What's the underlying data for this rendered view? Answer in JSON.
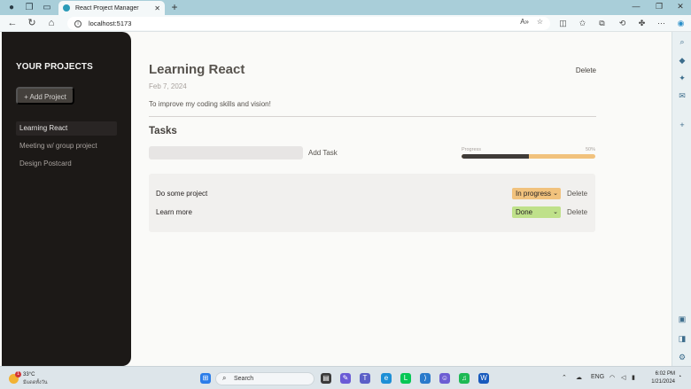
{
  "browser": {
    "tab_title": "React Project Manager",
    "url": "localhost:5173",
    "new_tab_glyph": "+",
    "close_tab_glyph": "✕"
  },
  "sidebar": {
    "heading": "YOUR PROJECTS",
    "add_button": "+ Add Project",
    "projects": [
      {
        "label": "Learning React",
        "active": true
      },
      {
        "label": "Meeting w/ group project",
        "active": false
      },
      {
        "label": "Design Postcard",
        "active": false
      }
    ]
  },
  "project": {
    "title": "Learning React",
    "delete_label": "Delete",
    "date": "Feb 7, 2024",
    "description": "To improve my coding skills and vision!"
  },
  "tasks_section": {
    "heading": "Tasks",
    "input_placeholder": "",
    "add_task_label": "Add Task",
    "progress_label": "Progress",
    "progress_value": 50,
    "progress_text": "50%",
    "tasks": [
      {
        "name": "Do some project",
        "status": "In progress",
        "status_color": "#f1c27d",
        "delete_label": "Delete"
      },
      {
        "name": "Learn more",
        "status": "Done",
        "status_color": "#bfe18a",
        "delete_label": "Delete"
      }
    ]
  },
  "taskbar": {
    "weather_temp": "33°C",
    "weather_desc": "มีแดดทั้งวัน",
    "weather_badge": "1",
    "search_label": "Search",
    "language": "ENG",
    "time": "6:02 PM",
    "date": "1/21/2024"
  },
  "colors": {
    "sidebar_bg": "#1c1917",
    "progress_fill": "#3f3b38",
    "progress_track": "#f1c27d",
    "status_in_progress": "#f1c27d",
    "status_done": "#bfe18a"
  }
}
